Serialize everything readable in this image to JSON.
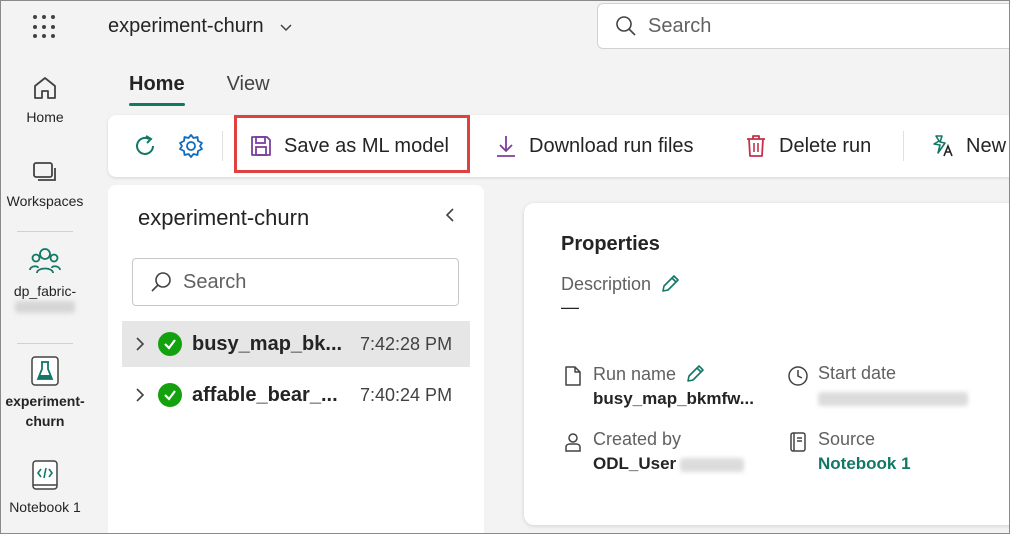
{
  "header": {
    "workspace_title": "experiment-churn",
    "search_placeholder": "Search"
  },
  "rail": {
    "home": "Home",
    "workspaces": "Workspaces",
    "workspace_item": "dp_fabric-",
    "experiment_line1": "experiment-",
    "experiment_line2": "churn",
    "notebook": "Notebook 1"
  },
  "tabs": [
    "Home",
    "View"
  ],
  "toolbar": {
    "save_ml_model": "Save as ML model",
    "download_run_files": "Download run files",
    "delete_run": "Delete run",
    "new": "New"
  },
  "left_panel": {
    "title": "experiment-churn",
    "search_placeholder": "Search",
    "runs": [
      {
        "name": "busy_map_bk...",
        "time": "7:42:28 PM"
      },
      {
        "name": "affable_bear_...",
        "time": "7:40:24 PM"
      }
    ]
  },
  "properties": {
    "title": "Properties",
    "description_label": "Description",
    "description_value": "—",
    "run_name_label": "Run name",
    "run_name_value": "busy_map_bkmfw...",
    "start_date_label": "Start date",
    "created_by_label": "Created by",
    "created_by_value": "ODL_User",
    "source_label": "Source",
    "source_value": "Notebook 1"
  },
  "colors": {
    "accent": "#117865",
    "highlight_box": "#e04040",
    "success": "#13a10e",
    "delete_icon": "#c4314b",
    "download_icon": "#7b3fa0"
  }
}
